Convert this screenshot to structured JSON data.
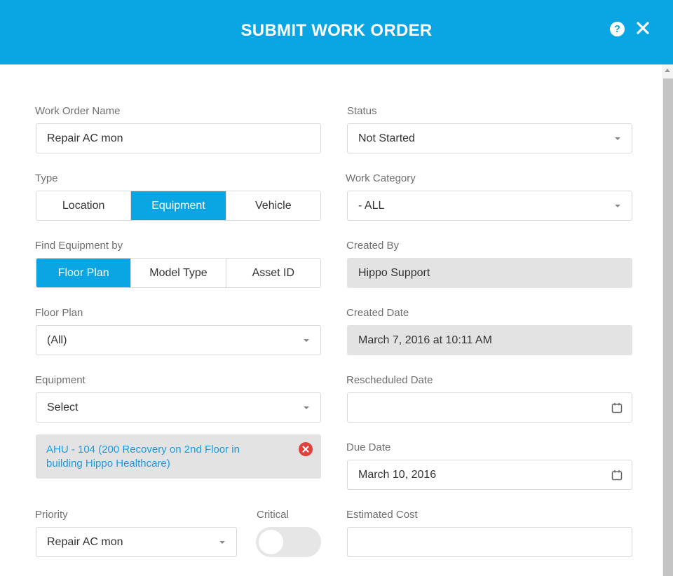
{
  "header": {
    "title": "SUBMIT WORK ORDER",
    "help_icon": "?"
  },
  "form": {
    "work_order_name": {
      "label": "Work Order Name",
      "value": "Repair AC mon"
    },
    "status": {
      "label": "Status",
      "value": "Not Started"
    },
    "type": {
      "label": "Type",
      "options": [
        "Location",
        "Equipment",
        "Vehicle"
      ],
      "selected": "Equipment"
    },
    "work_category": {
      "label": "Work Category",
      "value": "- ALL"
    },
    "find_equipment_by": {
      "label": "Find Equipment by",
      "options": [
        "Floor Plan",
        "Model Type",
        "Asset ID"
      ],
      "selected": "Floor Plan"
    },
    "created_by": {
      "label": "Created By",
      "value": "Hippo Support"
    },
    "floor_plan": {
      "label": "Floor Plan",
      "value": "(All)"
    },
    "created_date": {
      "label": "Created Date",
      "value": "March 7, 2016 at 10:11 AM"
    },
    "equipment": {
      "label": "Equipment",
      "value": "Select",
      "selected_item": "AHU - 104 (200 Recovery on 2nd Floor in building Hippo Healthcare)"
    },
    "rescheduled_date": {
      "label": "Rescheduled Date",
      "value": ""
    },
    "due_date": {
      "label": "Due Date",
      "value": "March 10, 2016"
    },
    "priority": {
      "label": "Priority",
      "value": "Repair AC mon"
    },
    "critical": {
      "label": "Critical",
      "enabled": false
    },
    "estimated_cost": {
      "label": "Estimated Cost",
      "value": ""
    }
  },
  "colors": {
    "accent": "#0aa6e4",
    "remove": "#e0413a",
    "link": "#1a9be0"
  }
}
